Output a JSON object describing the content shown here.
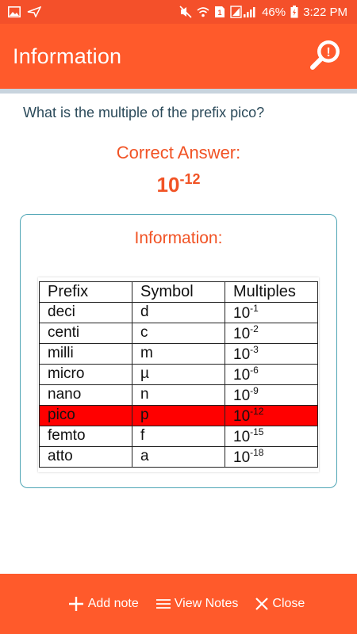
{
  "status_bar": {
    "battery": "46%",
    "time": "3:22 PM",
    "icons": [
      "gallery-icon",
      "send-icon",
      "mute-icon",
      "wifi-icon",
      "sim-icon",
      "signal-icon",
      "battery-charging-icon"
    ]
  },
  "app_bar": {
    "title": "Information",
    "action_icon": "search-icon"
  },
  "question": {
    "text": "What is the multiple of the prefix pico?"
  },
  "answer": {
    "label": "Correct Answer:",
    "base": "10",
    "exponent": "-12"
  },
  "info_card": {
    "title": "Information:",
    "table": {
      "headers": [
        "Prefix",
        "Symbol",
        "Multiples"
      ],
      "highlight_row": "pico",
      "highlight_color": "#ff0000",
      "rows": [
        {
          "prefix": "deci",
          "symbol": "d",
          "base": "10",
          "exp": "-1"
        },
        {
          "prefix": "centi",
          "symbol": "c",
          "base": "10",
          "exp": "-2"
        },
        {
          "prefix": "milli",
          "symbol": "m",
          "base": "10",
          "exp": "-3"
        },
        {
          "prefix": "micro",
          "symbol": "µ",
          "base": "10",
          "exp": "-6"
        },
        {
          "prefix": "nano",
          "symbol": "n",
          "base": "10",
          "exp": "-9"
        },
        {
          "prefix": "pico",
          "symbol": "p",
          "base": "10",
          "exp": "-12"
        },
        {
          "prefix": "femto",
          "symbol": "f",
          "base": "10",
          "exp": "-15"
        },
        {
          "prefix": "atto",
          "symbol": "a",
          "base": "10",
          "exp": "-18"
        }
      ]
    }
  },
  "bottom_bar": {
    "add_note": "Add note",
    "view_notes": "View Notes",
    "close": "Close"
  },
  "colors": {
    "accent": "#ff5a2b",
    "answer_text": "#f15325",
    "card_border": "#4fa5b5"
  }
}
